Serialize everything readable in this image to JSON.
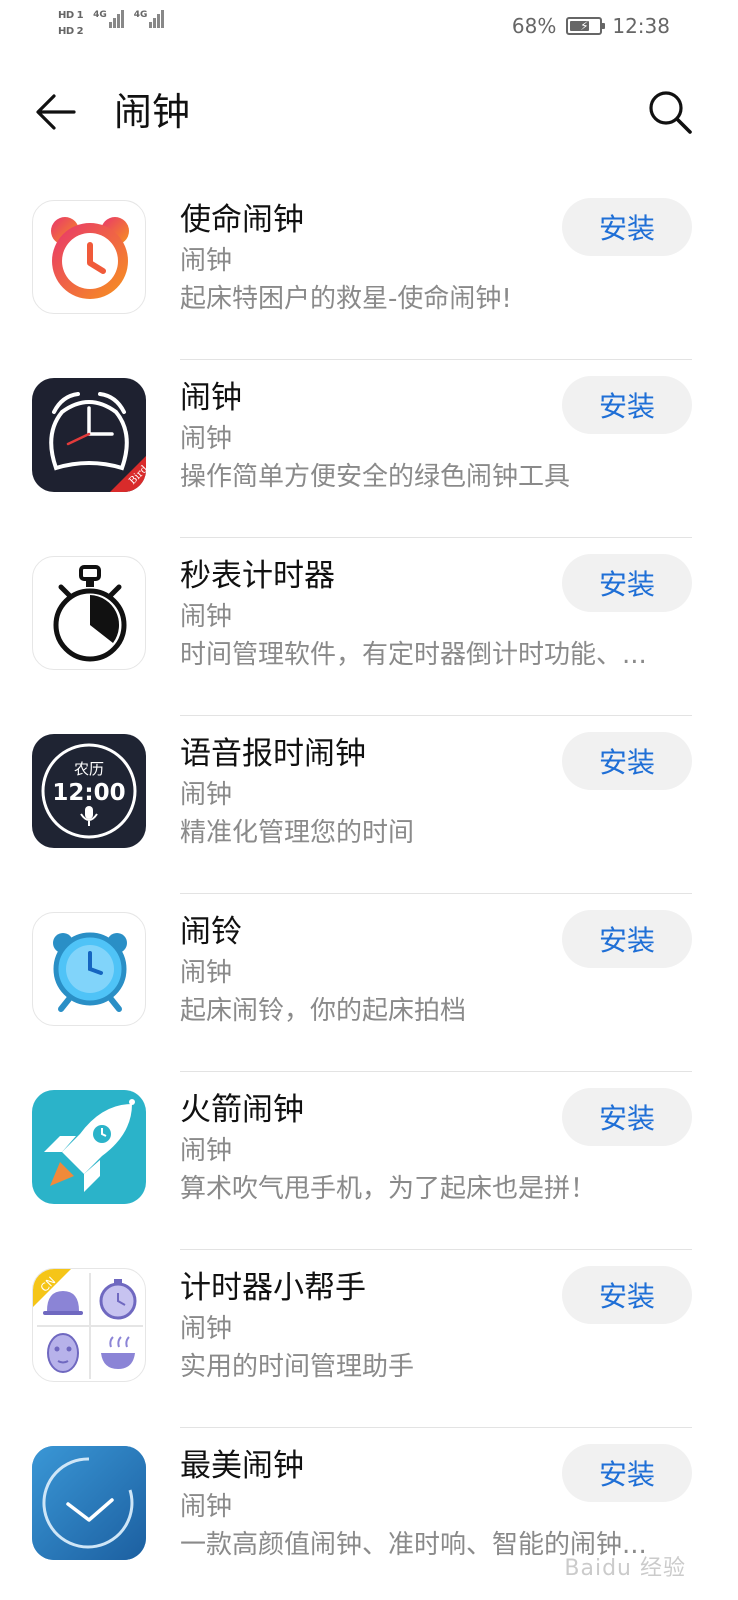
{
  "status_bar": {
    "hd1": "HD 1",
    "hd2": "HD 2",
    "signal1_label": "4G",
    "signal2_label": "4G",
    "battery_percent": "68%",
    "battery_level": 0.68,
    "time": "12:38"
  },
  "header": {
    "title": "闹钟",
    "back_icon": "arrow-left-icon",
    "search_icon": "search-icon"
  },
  "apps": [
    {
      "name": "使命闹钟",
      "category": "闹钟",
      "description": "起床特困户的救星-使命闹钟!",
      "button": "安装",
      "icon": "alarm-clock-orange-icon"
    },
    {
      "name": "闹钟",
      "category": "闹钟",
      "description": "操作简单方便安全的绿色闹钟工具",
      "button": "安装",
      "icon": "alarm-clock-dark-icon",
      "icon_badge": "Bird"
    },
    {
      "name": "秒表计时器",
      "category": "闹钟",
      "description": "时间管理软件，有定时器倒计时功能、...",
      "button": "安装",
      "icon": "stopwatch-icon"
    },
    {
      "name": "语音报时闹钟",
      "category": "闹钟",
      "description": "精准化管理您的时间",
      "button": "安装",
      "icon": "voice-clock-icon",
      "icon_text_top": "农历",
      "icon_text_time": "12:00"
    },
    {
      "name": "闹铃",
      "category": "闹钟",
      "description": "起床闹铃，你的起床拍档",
      "button": "安装",
      "icon": "blue-alarm-clock-icon"
    },
    {
      "name": "火箭闹钟",
      "category": "闹钟",
      "description": "算术吹气甩手机，为了起床也是拼！",
      "button": "安装",
      "icon": "rocket-icon"
    },
    {
      "name": "计时器小帮手",
      "category": "闹钟",
      "description": "实用的时间管理助手",
      "button": "安装",
      "icon": "timer-helper-grid-icon",
      "icon_badge": "CN"
    },
    {
      "name": "最美闹钟",
      "category": "闹钟",
      "description": "一款高颜值闹钟、准时响、智能的闹钟...",
      "button": "安装",
      "icon": "blue-clock-face-icon"
    }
  ],
  "watermark": "Baidu 经验"
}
